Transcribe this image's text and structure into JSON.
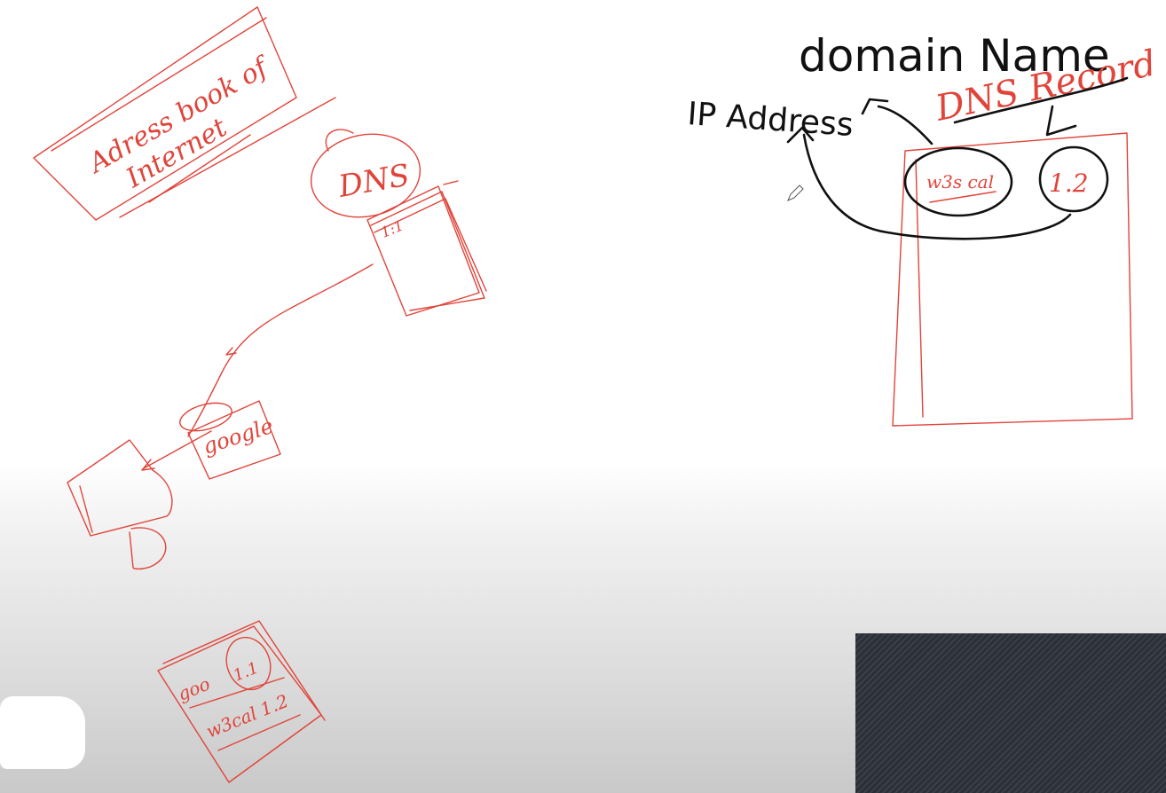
{
  "board": {
    "notes": {
      "address_book": [
        "Adress book of",
        "Internet"
      ],
      "dns": "DNS",
      "dns_entry": "1:1",
      "google": "google",
      "google_suffix": "",
      "record_google": "goo",
      "record_google_ip": "1.1",
      "record_site": "w3cal 1.2",
      "domain_name": "domain Name",
      "ip_address": "IP Address",
      "dns_record": "DNS Record",
      "record_domain": "w3s cal",
      "record_ip": "1.2"
    },
    "colors": {
      "red_ink": "#e0443a",
      "black_ink": "#111111",
      "webcam_bg": "#2b2f38"
    }
  },
  "overlay": {
    "webcam": "",
    "pen_cursor": "pen-icon"
  }
}
